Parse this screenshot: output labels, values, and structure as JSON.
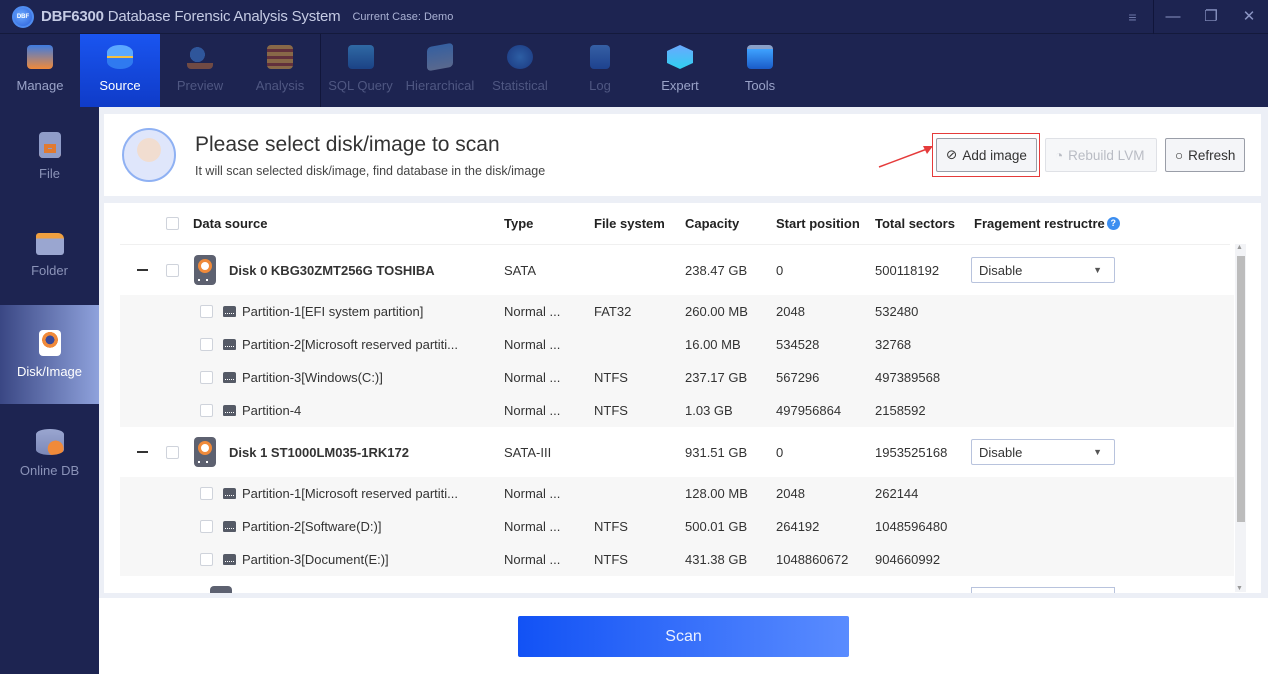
{
  "titlebar": {
    "logo_text": "DBF",
    "app_code": "DBF6300",
    "app_name": "Database Forensic Analysis System",
    "case_label": "Current Case: Demo",
    "menu_icon": "≡",
    "minimize": "—",
    "restore": "❐",
    "close": "✕"
  },
  "toolbar": {
    "items": [
      {
        "label": "Manage",
        "icon": "manage-icon"
      },
      {
        "label": "Source",
        "icon": "source-icon"
      },
      {
        "label": "Preview",
        "icon": "preview-icon"
      },
      {
        "label": "Analysis",
        "icon": "analysis-icon"
      },
      {
        "label": "SQL Query",
        "icon": "sql-query-icon"
      },
      {
        "label": "Hierarchical",
        "icon": "hierarchical-icon"
      },
      {
        "label": "Statistical",
        "icon": "statistical-icon"
      },
      {
        "label": "Log",
        "icon": "log-icon"
      },
      {
        "label": "Expert",
        "icon": "expert-icon"
      },
      {
        "label": "Tools",
        "icon": "tools-icon"
      }
    ],
    "active": "Source"
  },
  "sidebar": {
    "items": [
      {
        "label": "File",
        "icon": "file-icon"
      },
      {
        "label": "Folder",
        "icon": "folder-icon"
      },
      {
        "label": "Disk/Image",
        "icon": "disk-image-icon"
      },
      {
        "label": "Online DB",
        "icon": "online-db-icon"
      }
    ],
    "active": "Disk/Image"
  },
  "header": {
    "title": "Please select disk/image to scan",
    "subtitle": "It will scan selected disk/image, find database in the disk/image",
    "buttons": {
      "add_image": "Add image",
      "rebuild_lvm": "Rebuild LVM",
      "refresh": "Refresh"
    },
    "icons": {
      "add_image": "⊘",
      "rebuild_lvm": "◔",
      "refresh": "○"
    }
  },
  "table": {
    "columns": [
      "Data source",
      "Type",
      "File system",
      "Capacity",
      "Start position",
      "Total sectors",
      "Fragement restructre"
    ],
    "help_icon": "?",
    "disks": [
      {
        "name": "Disk 0 KBG30ZMT256G TOSHIBA",
        "type": "SATA",
        "fs": "",
        "capacity": "238.47 GB",
        "start": "0",
        "sectors": "500118192",
        "fragment": "Disable",
        "partitions": [
          {
            "name": "Partition-1[EFI system partition]",
            "type": "Normal ...",
            "fs": "FAT32",
            "capacity": "260.00 MB",
            "start": "2048",
            "sectors": "532480"
          },
          {
            "name": "Partition-2[Microsoft reserved partiti...",
            "type": "Normal ...",
            "fs": "",
            "capacity": "16.00 MB",
            "start": "534528",
            "sectors": "32768"
          },
          {
            "name": "Partition-3[Windows(C:)]",
            "type": "Normal ...",
            "fs": "NTFS",
            "capacity": "237.17 GB",
            "start": "567296",
            "sectors": "497389568"
          },
          {
            "name": "Partition-4",
            "type": "Normal ...",
            "fs": "NTFS",
            "capacity": "1.03 GB",
            "start": "497956864",
            "sectors": "2158592"
          }
        ]
      },
      {
        "name": "Disk 1 ST1000LM035-1RK172",
        "type": "SATA-III",
        "fs": "",
        "capacity": "931.51 GB",
        "start": "0",
        "sectors": "1953525168",
        "fragment": "Disable",
        "partitions": [
          {
            "name": "Partition-1[Microsoft reserved partiti...",
            "type": "Normal ...",
            "fs": "",
            "capacity": "128.00 MB",
            "start": "2048",
            "sectors": "262144"
          },
          {
            "name": "Partition-2[Software(D:)]",
            "type": "Normal ...",
            "fs": "NTFS",
            "capacity": "500.01 GB",
            "start": "264192",
            "sectors": "1048596480"
          },
          {
            "name": "Partition-3[Document(E:)]",
            "type": "Normal ...",
            "fs": "NTFS",
            "capacity": "431.38 GB",
            "start": "1048860672",
            "sectors": "904660992"
          }
        ]
      }
    ]
  },
  "scan": {
    "label": "Scan"
  },
  "colors": {
    "nav_bg": "#1d2451",
    "active_tab": "#1a55f0",
    "scan_start": "#1252f5",
    "scan_end": "#5a8cff",
    "highlight": "#e53b3b"
  }
}
